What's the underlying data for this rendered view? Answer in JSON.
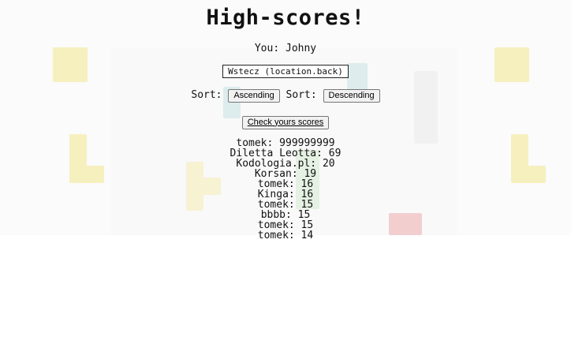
{
  "title": "High-scores!",
  "player_line": "You: Johny",
  "back_button_label": "Wstecz (location.back)",
  "sort": {
    "label1": "Sort:",
    "ascending_label": "Ascending",
    "label2": "Sort:",
    "descending_label": "Descending"
  },
  "check_button_label": "Check yours scores",
  "scores": [
    "tomek: 999999999",
    "Diletta Leotta: 69",
    "Kodologia.pl: 20",
    "Korsan: 19",
    "tomek: 16",
    "Kinga: 16",
    "tomek: 15",
    "bbbb: 15",
    "tomek: 15",
    "tomek: 14"
  ],
  "colors": {
    "yellow_block": "#f6f0bf",
    "teal_block": "#cfe6e8",
    "green_block": "#dcefd8",
    "red_block": "#f0b9b9",
    "gray_block": "#eeeeee"
  }
}
